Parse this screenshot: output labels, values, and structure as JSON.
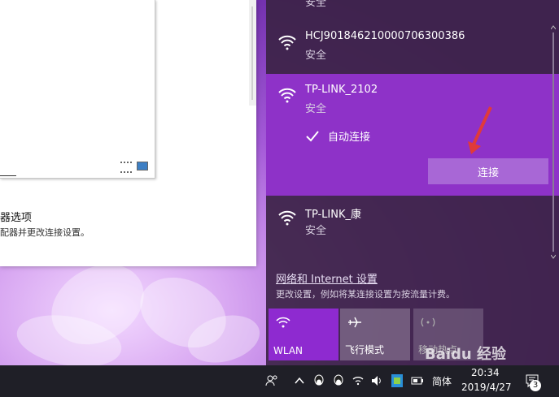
{
  "window": {
    "option_title": "器选项",
    "option_desc": "配器并更改连接设置。"
  },
  "flyout": {
    "top_partial_sub": "安全",
    "networks": [
      {
        "name": "HCJ90184621000070630038​6",
        "status": "安全"
      },
      {
        "name": "TP-LINK_2102",
        "status": "安全",
        "selected": true,
        "auto_connect_label": "自动连接",
        "connect_label": "连接"
      },
      {
        "name": "TP-LINK_康",
        "status": "安全"
      }
    ],
    "settings_link": "网络和 Internet 设置",
    "settings_desc": "更改设置，例如将某连接设置为按流量计费。",
    "tiles": [
      {
        "label": "WLAN",
        "icon": "wifi-icon",
        "active": true
      },
      {
        "label": "飞行模式",
        "icon": "airplane-icon",
        "active": false
      },
      {
        "label": "移动热点",
        "icon": "hotspot-icon",
        "active": false
      }
    ]
  },
  "taskbar": {
    "input_method": "简体",
    "time": "20:34",
    "date": "2019/4/27",
    "notification_count": "3"
  },
  "watermark": "Baidu 经验",
  "colors": {
    "selected_network": "#8e32c8",
    "connect_button": "#a867d6",
    "wlan_tile": "#8e2ad0",
    "arrow": "#e03a3a"
  }
}
